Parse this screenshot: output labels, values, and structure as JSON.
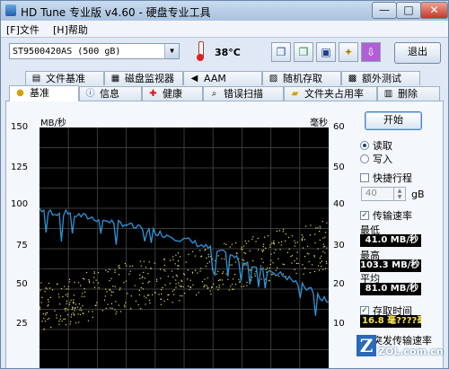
{
  "window": {
    "title": "HD Tune 专业版 v4.60 - 硬盘专业工具",
    "btn_minimize": "—",
    "btn_maximize": "□",
    "btn_close": "✕"
  },
  "menu": {
    "file": "[F]文件",
    "help": "[H]帮助"
  },
  "toolbar": {
    "drive": "ST9500420AS (500 gB)",
    "temperature": "38°C",
    "exit": "退出"
  },
  "tabs_top": [
    "文件基准",
    "磁盘监视器",
    "AAM",
    "随机存取",
    "额外测试"
  ],
  "tabs_bottom": [
    "基准",
    "信息",
    "健康",
    "错误扫描",
    "文件夹占用率",
    "删除"
  ],
  "chart_data": {
    "type": "line",
    "y_left_label": "MB/秒",
    "y_right_label": "毫秒",
    "y_left_ticks": [
      "150",
      "125",
      "100",
      "75",
      "50",
      "25"
    ],
    "y_right_ticks": [
      "60",
      "50",
      "40",
      "30",
      "20",
      "10"
    ],
    "ylim_left": [
      0,
      150
    ],
    "ylim_right": [
      0,
      60
    ],
    "grid": true,
    "series": [
      {
        "values": [
          100,
          98,
          97,
          97,
          96,
          95,
          94,
          93,
          92,
          91,
          90,
          88,
          87,
          86,
          84,
          83,
          81,
          80,
          78,
          76,
          74,
          72,
          70,
          68,
          66,
          64,
          62,
          60,
          58,
          55,
          52,
          49,
          45,
          42
        ]
      }
    ]
  },
  "sidebar": {
    "start": "开始",
    "read": "读取",
    "write": "写入",
    "short_stroke": "快捷行程",
    "short_stroke_value": "40",
    "short_stroke_unit": "gB",
    "transfer_rate": "传输速率",
    "min_label": "最低",
    "min_value": "41.0 MB/秒",
    "max_label": "最高",
    "max_value": "103.3 MB/秒",
    "avg_label": "平均",
    "avg_value": "81.0 MB/秒",
    "access_time": "存取时间",
    "access_value": "16.8 毫????毫?",
    "burst_rate": "突发传输速率"
  },
  "watermark": {
    "letter": "Z",
    "text": "ZOL.com.cn"
  }
}
